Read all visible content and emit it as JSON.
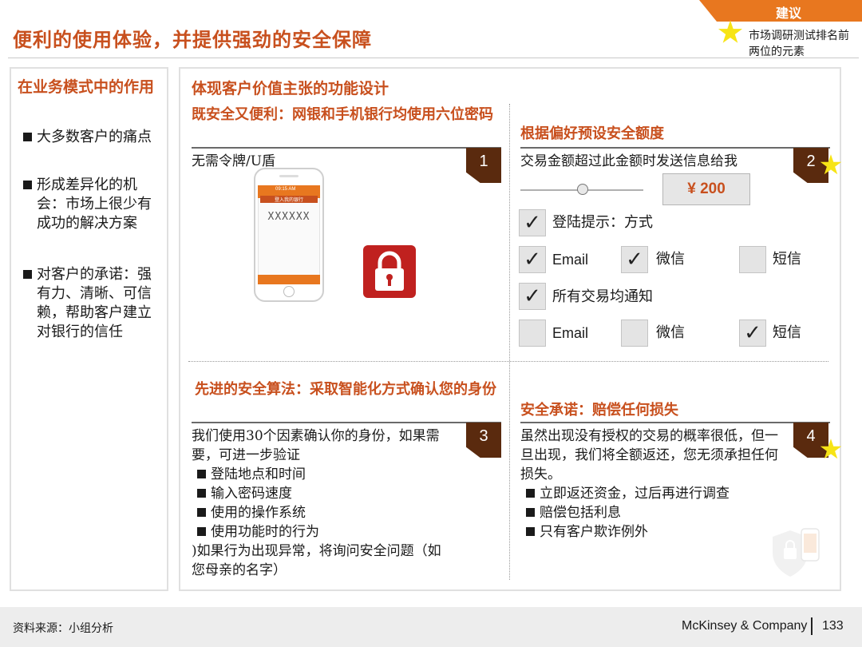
{
  "header": {
    "tag": "建议",
    "title": "便利的使用体验，并提供强劲的安全保障",
    "tag_note": "市场调研测试排名前两位的元素",
    "star_icon": "star-icon",
    "accent_color": "#c8501e",
    "tag_color": "#e8771f"
  },
  "left_panel": {
    "heading": "在业务模式中的作用",
    "bullets": [
      "大多数客户的痛点",
      "形成差异化的机会：市场上很少有成功的解决方案",
      "对客户的承诺：强有力、清晰、可信赖，帮助客户建立对银行的信任"
    ]
  },
  "main_panel": {
    "heading": "体现客户价值主张的功能设计",
    "q1": {
      "number": "1",
      "title": "既安全又便利：网银和手机银行均使用六位密码",
      "text": "无需令牌/U盾",
      "phone_caption": "登入我的银行",
      "phone_code": "XXXXXX",
      "phone_time": "09:15 AM",
      "lock_icon": "padlock-icon"
    },
    "q2": {
      "number": "2",
      "title": "根据偏好预设安全额度",
      "text": "交易金额超过此金额时发送信息给我",
      "amount": "¥ 200",
      "login_alert": "登陆提示：方式",
      "all_notify": "所有交易均通知",
      "row1": {
        "email": "Email",
        "wechat": "微信",
        "sms": "短信"
      },
      "row2": {
        "email": "Email",
        "wechat": "微信",
        "sms": "短信"
      },
      "check_glyph": "✓"
    },
    "q3": {
      "number": "3",
      "title": "先进的安全算法：采取智能化方式确认您的身份",
      "intro": "我们使用30个因素确认你的身份，如果需要，可进一步验证",
      "bullets": [
        "登陆地点和时间",
        "输入密码速度",
        "使用的操作系统",
        "使用功能时的行为"
      ],
      "outro": ")如果行为出现异常，将询问安全问题（如您母亲的名字）"
    },
    "q4": {
      "number": "4",
      "title": "安全承诺：赔偿任何损失",
      "intro": "虽然出现没有授权的交易的概率很低，但一旦出现，我们将全额返还，您无须承担任何损失。",
      "bullets": [
        "立即返还资金，过后再进行调查",
        "赔偿包括利息",
        "只有客户欺诈例外"
      ]
    }
  },
  "footer": {
    "source": "资料来源：小组分析",
    "company": "McKinsey & Company",
    "page": "133"
  }
}
